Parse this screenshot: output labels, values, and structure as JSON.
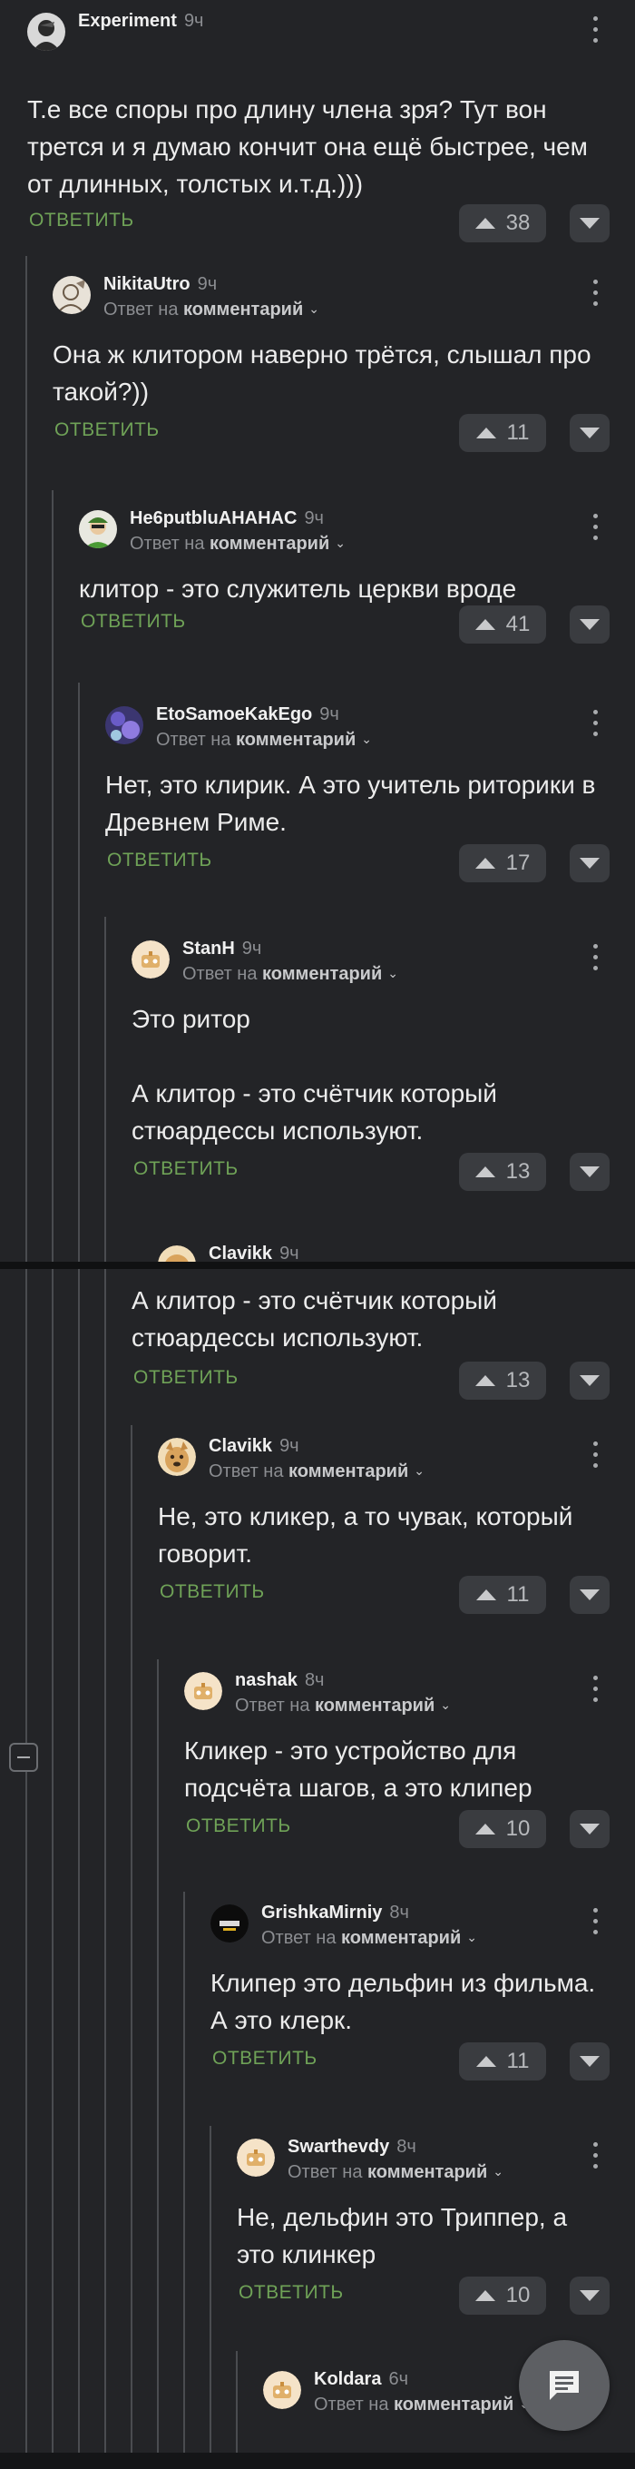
{
  "ui": {
    "reply_label": "ОТВЕТИТЬ",
    "reply_to_prefix": "Ответ на",
    "reply_to_target": "комментарий"
  },
  "comments": [
    {
      "author": "Experiment",
      "time": "9ч",
      "text": "Т.е все споры про длину члена зря? Тут вон трется и я думаю кончит она ещё быстрее, чем от длинных, толстых и.т.д.)))",
      "rating": "38",
      "avatar": "dark-avatar"
    },
    {
      "author": "NikitaUtro",
      "time": "9ч",
      "text": "Она ж клитором наверно трётся, слышал про такой?))",
      "rating": "11",
      "avatar": "sketch-avatar"
    },
    {
      "author": "He6putbluAHAHAC",
      "time": "9ч",
      "text": "клитор - это служитель церкви вроде",
      "rating": "41",
      "avatar": "green-avatar"
    },
    {
      "author": "EtoSamoeKakEgo",
      "time": "9ч",
      "text": "Нет, это клирик. А это учитель риторики в Древнем Риме.",
      "rating": "17",
      "avatar": "purple-avatar"
    },
    {
      "author": "StanH",
      "time": "9ч",
      "text_1": "Это ритор",
      "text_2": "А клитор - это счётчик который стюардессы используют.",
      "rating": "13",
      "avatar": "default-avatar"
    },
    {
      "author": "Clavikk",
      "time": "9ч",
      "text": "Не, это кликер, а то чувак, который говорит.",
      "rating": "11",
      "avatar": "doge-avatar"
    },
    {
      "author": "nashak",
      "time": "8ч",
      "text": "Кликер - это устройство для подсчёта шагов, а это клипер",
      "rating": "10",
      "avatar": "default-avatar"
    },
    {
      "author": "GrishkaMirniy",
      "time": "8ч",
      "text": "Клипер это дельфин из фильма. А это клерк.",
      "rating": "11",
      "avatar": "black-avatar"
    },
    {
      "author": "Swarthevdy",
      "time": "8ч",
      "text": "Не, дельфин это Триппер, а это клинкер",
      "rating": "10",
      "avatar": "default-avatar"
    },
    {
      "author": "Koldara",
      "time": "6ч",
      "avatar": "default-avatar"
    }
  ],
  "colors": {
    "background": "#232427",
    "reply": "#6fa257",
    "thread_line": "#4a4c50",
    "rating_bg": "#3a3c40"
  }
}
